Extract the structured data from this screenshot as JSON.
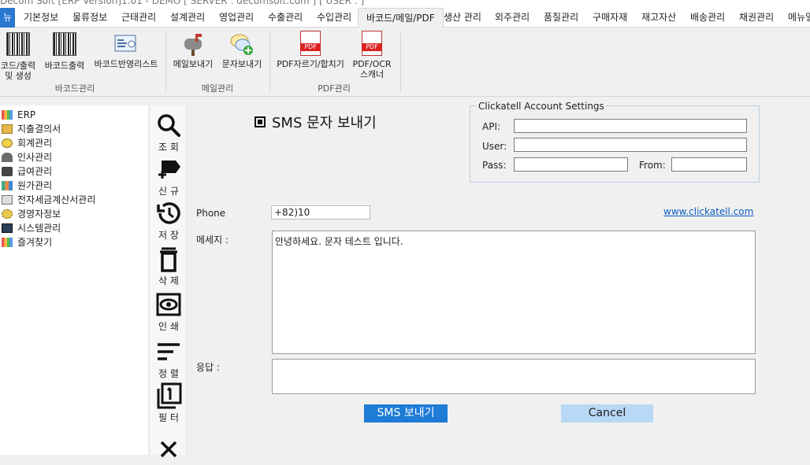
{
  "window": {
    "title": "Decom Soft [ERP Version]1.01 - DEMO  [ SERVER : decomsoft.com ]  [ USER : ]"
  },
  "menubar": {
    "file": "뉴",
    "items": [
      "기본정보",
      "물류정보",
      "근태관리",
      "설계관리",
      "영업관리",
      "수출관리",
      "수입관리",
      "바코드/메일/PDF",
      "생산 관리",
      "외주관리",
      "품질관리",
      "구매자재",
      "재고자산",
      "배송관리",
      "채권관리",
      "메뉴얼"
    ]
  },
  "ribbon": {
    "buttons": [
      {
        "label": "코드/출력\n및 생성",
        "icon": "barcode-icon"
      },
      {
        "label": "바코드출력",
        "icon": "barcode-icon"
      },
      {
        "label": "바코드반영리스트",
        "icon": "barcode-list-icon"
      },
      {
        "label": "메일보내기",
        "icon": "mailbox-icon"
      },
      {
        "label": "문자보내기",
        "icon": "chat-add-icon"
      },
      {
        "label": "PDF자르기/합치기",
        "icon": "pdf-icon"
      },
      {
        "label": "PDF/OCR\n스캐너",
        "icon": "pdf-icon"
      }
    ],
    "groups": [
      "바코드관리",
      "메일관리",
      "PDF관리"
    ]
  },
  "sidebar": {
    "items": [
      "ERP",
      "지출결의서",
      "회계관리",
      "인사관리",
      "급여관리",
      "원가관리",
      "전자세금계산서관리",
      "경영자정보",
      "시스템관리",
      "즐겨찾기"
    ]
  },
  "toolbar": {
    "items": [
      {
        "label": "조 회",
        "icon": "search-icon"
      },
      {
        "label": "신 규",
        "icon": "new-record-icon"
      },
      {
        "label": "저 장",
        "icon": "save-history-icon"
      },
      {
        "label": "삭 제",
        "icon": "trash-icon"
      },
      {
        "label": "인 쇄",
        "icon": "eye-icon"
      },
      {
        "label": "정 렬",
        "icon": "sort-icon"
      },
      {
        "label": "필 터",
        "icon": "filter-icon"
      },
      {
        "label": "",
        "icon": "close-icon"
      }
    ]
  },
  "form": {
    "title": "SMS 문자 보내기",
    "account": {
      "legend": "Clickatell Account Settings",
      "api_label": "API:",
      "user_label": "User:",
      "pass_label": "Pass:",
      "from_label": "From:",
      "api_value": "",
      "user_value": "",
      "pass_value": "",
      "from_value": ""
    },
    "phone_label": "Phone",
    "phone_value": "+82)10",
    "link": "www.clickatell.com",
    "message_label": "메세지 :",
    "message_value": "안녕하세요. 문자 테스트 입니다.",
    "response_label": "응답  :",
    "response_value": "",
    "send_button": "SMS 보내기",
    "cancel_button": "Cancel"
  },
  "colors": {
    "accent": "#1e7bd6",
    "cancel": "#b8d8f5",
    "link": "#0b5fbf"
  }
}
